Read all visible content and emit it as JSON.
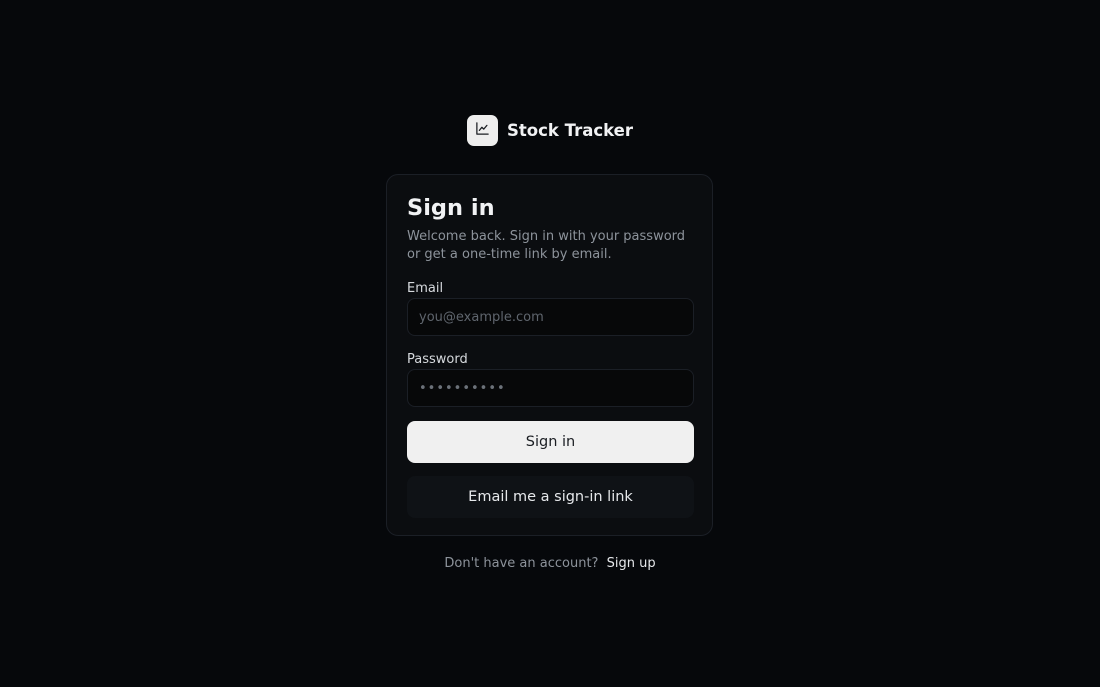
{
  "brand": {
    "name": "Stock Tracker",
    "icon": "line-chart-icon"
  },
  "card": {
    "title": "Sign in",
    "subtitle": "Welcome back. Sign in with your password or get a one-time link by email."
  },
  "form": {
    "email_label": "Email",
    "email_placeholder": "you@example.com",
    "email_value": "",
    "password_label": "Password",
    "password_placeholder": "••••••••••",
    "password_value": "",
    "sign_in_label": "Sign in",
    "magic_link_label": "Email me a sign-in link"
  },
  "footer": {
    "prompt": "Don't have an account?",
    "sign_up_label": "Sign up"
  },
  "colors": {
    "background": "#06080b",
    "card": "#0b0d10",
    "primary_button": "#f0f0f0",
    "accent_text": "#e6e8eb"
  }
}
